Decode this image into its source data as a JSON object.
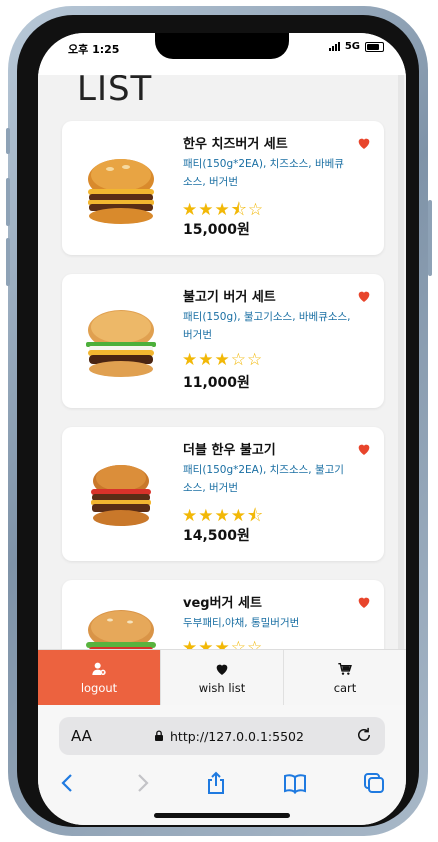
{
  "status_bar": {
    "time": "오후 1:25",
    "network": "5G"
  },
  "page": {
    "title": "LIST"
  },
  "products": [
    {
      "name": "한우 치즈버거 세트",
      "description": "패티(150g*2EA), 치즈소스, 바베큐소스, 버거번",
      "rating_text": "★★★⯪☆",
      "rating": 3.5,
      "price": "15,000원",
      "liked": true
    },
    {
      "name": "불고기 버거 세트",
      "description": "패티(150g), 불고기소스, 바베큐소스, 버거번",
      "rating_text": "★★★☆☆",
      "rating": 3,
      "price": "11,000원",
      "liked": true
    },
    {
      "name": "더블 한우 불고기",
      "description": "패티(150g*2EA), 치즈소스, 불고기소스, 버거번",
      "rating_text": "★★★★⯪",
      "rating": 4.5,
      "price": "14,500원",
      "liked": true
    },
    {
      "name": "veg버거 세트",
      "description": "두부패티,야채, 통밀버거번",
      "rating_text": "★★★☆☆",
      "rating": 3,
      "price": "",
      "liked": true
    }
  ],
  "tabs": [
    {
      "label": "logout",
      "icon": "user-logout-icon",
      "active": true
    },
    {
      "label": "wish list",
      "icon": "heart-icon",
      "active": false
    },
    {
      "label": "cart",
      "icon": "cart-icon",
      "active": false
    }
  ],
  "browser": {
    "text_size_label": "AA",
    "url": "http://127.0.0.1:5502"
  },
  "colors": {
    "accent": "#ec623f",
    "heart": "#e8452c",
    "star": "#f2b807",
    "link_blue": "#1a6fa3"
  }
}
